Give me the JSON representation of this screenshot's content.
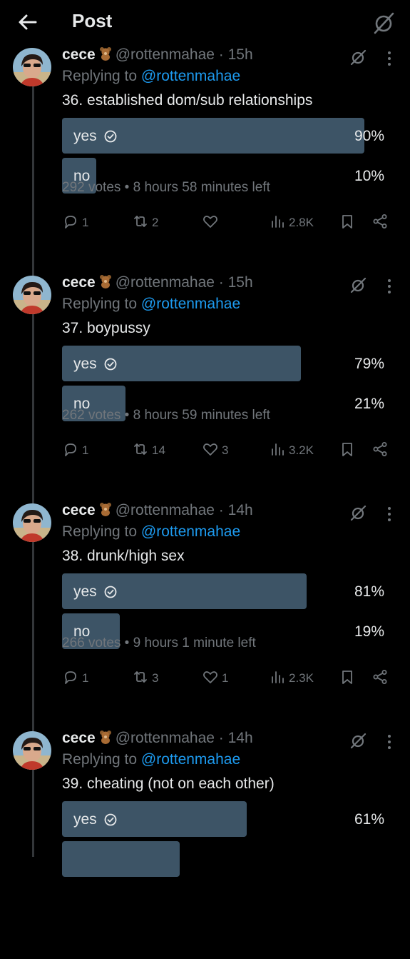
{
  "header": {
    "title": "Post",
    "back_icon": "arrow-left-icon",
    "grok_icon": "grok-icon"
  },
  "colors": {
    "background": "#000000",
    "bar": "#3d5466",
    "link": "#1d9bf0",
    "muted": "#71767b",
    "text": "#e7e9ea"
  },
  "tweets": [
    {
      "author": "cece",
      "handle": "@rottenmahae",
      "time": "· 15h",
      "replying_prefix": "Replying to",
      "replying_to": "@rottenmahae",
      "text": "36. established dom/sub relationships",
      "options": [
        {
          "label": "yes",
          "pct_label": "90%",
          "fraction": 1.0,
          "chosen": true
        },
        {
          "label": "no",
          "pct_label": "10%",
          "fraction": 0.1,
          "chosen": false
        }
      ],
      "votes": "292 votes",
      "time_left": "8 hours 58 minutes left",
      "replies": "1",
      "reposts": "2",
      "likes": "",
      "views": "2.8K"
    },
    {
      "author": "cece",
      "handle": "@rottenmahae",
      "time": "· 15h",
      "replying_prefix": "Replying to",
      "replying_to": "@rottenmahae",
      "text": "37. boypussy",
      "options": [
        {
          "label": "yes",
          "pct_label": "79%",
          "fraction": 0.79,
          "chosen": true
        },
        {
          "label": "no",
          "pct_label": "21%",
          "fraction": 0.21,
          "chosen": false
        }
      ],
      "votes": "262 votes",
      "time_left": "8 hours 59 minutes left",
      "replies": "1",
      "reposts": "14",
      "likes": "3",
      "views": "3.2K"
    },
    {
      "author": "cece",
      "handle": "@rottenmahae",
      "time": "· 14h",
      "replying_prefix": "Replying to",
      "replying_to": "@rottenmahae",
      "text": "38. drunk/high sex",
      "options": [
        {
          "label": "yes",
          "pct_label": "81%",
          "fraction": 0.81,
          "chosen": true
        },
        {
          "label": "no",
          "pct_label": "19%",
          "fraction": 0.19,
          "chosen": false
        }
      ],
      "votes": "266 votes",
      "time_left": "9 hours 1 minute left",
      "replies": "1",
      "reposts": "3",
      "likes": "1",
      "views": "2.3K"
    },
    {
      "author": "cece",
      "handle": "@rottenmahae",
      "time": "· 14h",
      "replying_prefix": "Replying to",
      "replying_to": "@rottenmahae",
      "text": "39. cheating (not on each other)",
      "options": [
        {
          "label": "yes",
          "pct_label": "61%",
          "fraction": 0.61,
          "chosen": true
        },
        {
          "label": "",
          "pct_label": "",
          "fraction": 0.39,
          "chosen": false
        }
      ],
      "votes": "",
      "time_left": "",
      "replies": "",
      "reposts": "",
      "likes": "",
      "views": ""
    }
  ]
}
